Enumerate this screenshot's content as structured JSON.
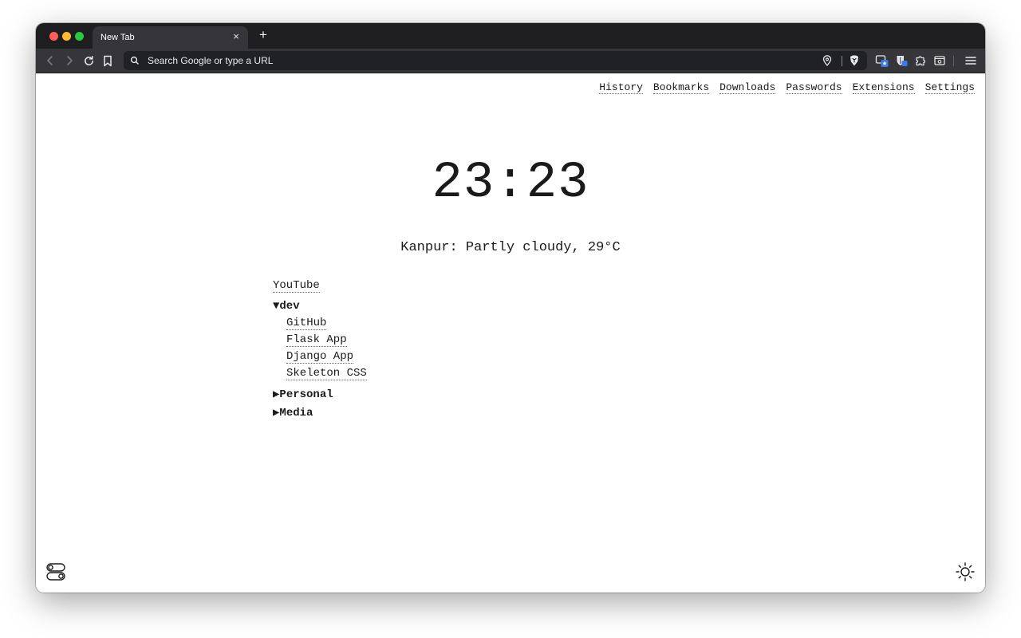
{
  "browser": {
    "tab_title": "New Tab",
    "tab_close_glyph": "×",
    "new_tab_glyph": "+",
    "address_placeholder": "Search Google or type a URL",
    "icons": [
      "back-icon",
      "forward-icon",
      "reload-icon",
      "bookmark-icon",
      "search-icon",
      "location-icon",
      "brave-shield-icon",
      "tab-search-icon",
      "bitwarden-icon",
      "extensions-icon",
      "reader-mode-icon",
      "menu-icon"
    ]
  },
  "nav_links": [
    "History",
    "Bookmarks",
    "Downloads",
    "Passwords",
    "Extensions",
    "Settings"
  ],
  "clock": "23:23",
  "weather": "Kanpur: Partly cloudy, 29°C",
  "bookmarks": {
    "top_link": "YouTube",
    "dev_folder": "▼dev",
    "dev_links": [
      "GitHub",
      "Flask App",
      "Django App",
      "Skeleton CSS"
    ],
    "personal_folder": "▶Personal",
    "media_folder": "▶Media"
  },
  "footer": {
    "left_icon": "toggles-icon",
    "right_icon": "sun-icon"
  },
  "colors": {
    "tabstrip_bg": "#1e1e20",
    "toolbar_bg": "#36363a",
    "omnibox_bg": "#202124",
    "page_bg": "#ffffff",
    "text": "#1a1a1a"
  }
}
